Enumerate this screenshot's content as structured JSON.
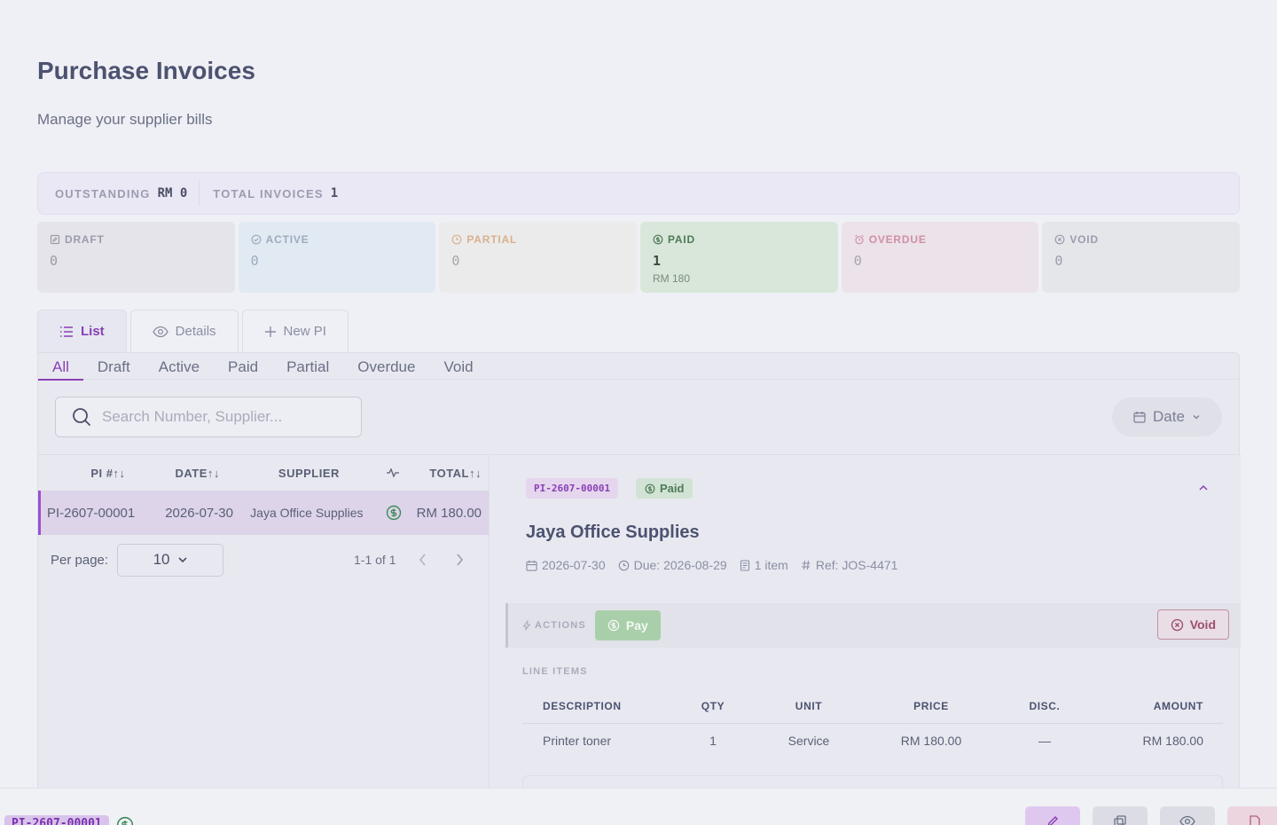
{
  "page": {
    "title": "Purchase Invoices",
    "subtitle": "Manage your supplier bills"
  },
  "summary": {
    "outstanding_label": "OUTSTANDING",
    "outstanding_value": "RM 0",
    "total_label": "TOTAL INVOICES",
    "total_value": "1"
  },
  "status_cards": [
    {
      "label": "DRAFT",
      "count": "0",
      "icon": "draft-icon"
    },
    {
      "label": "ACTIVE",
      "count": "0",
      "icon": "check-circle-icon"
    },
    {
      "label": "PARTIAL",
      "count": "0",
      "icon": "clock-icon"
    },
    {
      "label": "PAID",
      "count": "1",
      "amount": "RM 180",
      "icon": "dollar-circle-icon"
    },
    {
      "label": "OVERDUE",
      "count": "0",
      "icon": "alarm-icon"
    },
    {
      "label": "VOID",
      "count": "0",
      "icon": "x-circle-icon"
    }
  ],
  "colors": {
    "accent": "#8a3fb5",
    "paid_green": "#4e7a58",
    "void_red": "#9d4f6c"
  },
  "main_tabs": [
    {
      "label": "List",
      "icon": "list-icon"
    },
    {
      "label": "Details",
      "icon": "eye-icon"
    },
    {
      "label": "New PI",
      "icon": "plus-icon"
    }
  ],
  "filter_tabs": [
    "All",
    "Draft",
    "Active",
    "Paid",
    "Partial",
    "Overdue",
    "Void"
  ],
  "search": {
    "placeholder": "Search Number, Supplier..."
  },
  "date_filter": {
    "label": "Date"
  },
  "list": {
    "columns": {
      "pi": "PI #↑↓",
      "date": "DATE↑↓",
      "supplier": "SUPPLIER",
      "total": "TOTAL↑↓"
    },
    "rows": [
      {
        "pi": "PI-2607-00001",
        "date": "2026-07-30",
        "supplier": "Jaya Office Supplies",
        "total": "RM 180.00"
      }
    ],
    "per_page_label": "Per page:",
    "per_page_value": "10",
    "range": "1-1 of 1"
  },
  "detail": {
    "number": "PI-2607-00001",
    "status": "Paid",
    "supplier": "Jaya Office Supplies",
    "date": "2026-07-30",
    "due": "Due: 2026-08-29",
    "items": "1 item",
    "ref": "Ref: JOS-4471",
    "actions_label": "ACTIONS",
    "pay_label": "Pay",
    "void_label": "Void",
    "line_items_label": "LINE ITEMS",
    "line_item_columns": {
      "description": "DESCRIPTION",
      "qty": "QTY",
      "unit": "UNIT",
      "price": "PRICE",
      "disc": "DISC.",
      "amount": "AMOUNT"
    },
    "line_items": [
      {
        "description": "Printer toner",
        "qty": "1",
        "unit": "Service",
        "price": "RM 180.00",
        "disc": "—",
        "amount": "RM 180.00"
      }
    ]
  },
  "bottom_bar": {
    "number": "PI-2607-00001"
  }
}
